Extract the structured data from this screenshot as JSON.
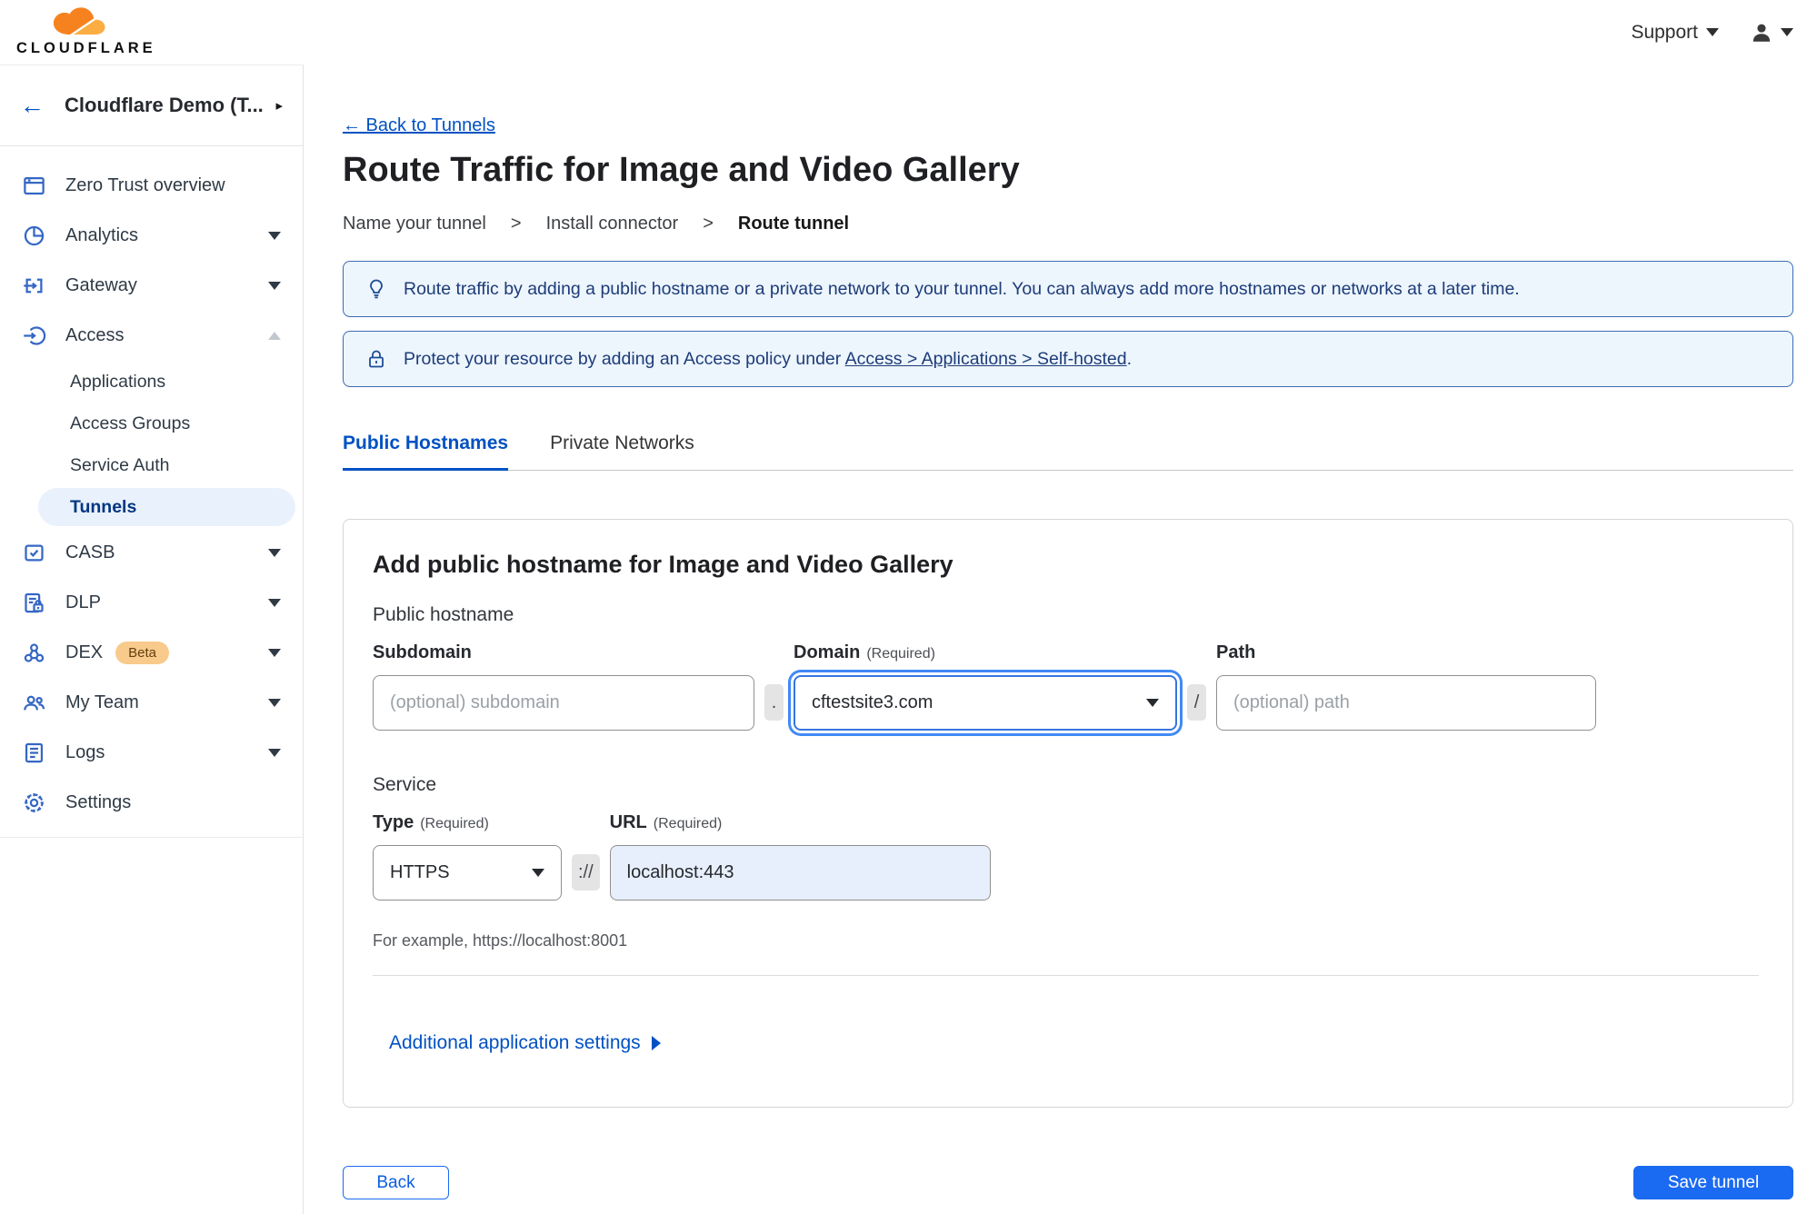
{
  "colors": {
    "accent_blue": "#0051c3",
    "button_blue": "#1a6af2",
    "banner_border": "#3b6cb4",
    "banner_bg": "#edf5fd",
    "active_pill_bg": "#e9f1fc",
    "active_pill_text": "#003681",
    "logo_orange": "#f6821f",
    "logo_orange_light": "#fbad41",
    "beta_badge_bg": "#f8ca8b",
    "url_field_bg": "#e7effc"
  },
  "header": {
    "logo_text": "CLOUDFLARE",
    "support_label": "Support",
    "icons": [
      "support-chevron",
      "user-avatar",
      "user-chevron"
    ]
  },
  "sidebar": {
    "team_name": "Cloudflare Demo (T...",
    "back_arrow": "←",
    "expand_arrow": "▸",
    "items": [
      {
        "label": "Zero Trust overview",
        "icon": "overview-icon",
        "chevron": "none"
      },
      {
        "label": "Analytics",
        "icon": "analytics-icon",
        "chevron": "down"
      },
      {
        "label": "Gateway",
        "icon": "gateway-icon",
        "chevron": "down"
      },
      {
        "label": "Access",
        "icon": "access-icon",
        "chevron": "up"
      },
      {
        "label": "CASB",
        "icon": "casb-icon",
        "chevron": "down"
      },
      {
        "label": "DLP",
        "icon": "dlp-icon",
        "chevron": "down"
      },
      {
        "label": "DEX",
        "icon": "dex-icon",
        "chevron": "down",
        "badge": "Beta"
      },
      {
        "label": "My Team",
        "icon": "team-icon",
        "chevron": "down"
      },
      {
        "label": "Logs",
        "icon": "logs-icon",
        "chevron": "down"
      },
      {
        "label": "Settings",
        "icon": "settings-icon",
        "chevron": "none"
      }
    ],
    "access_subitems": [
      {
        "label": "Applications",
        "active": false
      },
      {
        "label": "Access Groups",
        "active": false
      },
      {
        "label": "Service Auth",
        "active": false
      },
      {
        "label": "Tunnels",
        "active": true
      }
    ]
  },
  "page": {
    "back_link": "← Back to Tunnels",
    "title": "Route Traffic for Image and Video Gallery",
    "steps": [
      "Name your tunnel",
      "Install connector",
      "Route tunnel"
    ],
    "step_separator": ">"
  },
  "banners": [
    {
      "icon": "lightbulb-icon",
      "text": "Route traffic by adding a public hostname or a private network to your tunnel. You can always add more hostnames or networks at a later time."
    },
    {
      "icon": "lock-icon",
      "text_prefix": "Protect your resource by adding an Access policy under ",
      "link_text": "Access > Applications > Self-hosted",
      "text_suffix": "."
    }
  ],
  "tabs": [
    {
      "label": "Public Hostnames",
      "active": true
    },
    {
      "label": "Private Networks",
      "active": false
    }
  ],
  "form": {
    "heading": "Add public hostname for Image and Video Gallery",
    "public_hostname_label": "Public hostname",
    "subdomain": {
      "label": "Subdomain",
      "placeholder": "(optional) subdomain",
      "value": ""
    },
    "domain": {
      "label": "Domain",
      "required": "(Required)",
      "value": "cftestsite3.com"
    },
    "path": {
      "label": "Path",
      "placeholder": "(optional) path",
      "value": ""
    },
    "separators": {
      "dot": ".",
      "slash": "/",
      "scheme": "://"
    },
    "service_label": "Service",
    "type": {
      "label": "Type",
      "required": "(Required)",
      "value": "HTTPS"
    },
    "url": {
      "label": "URL",
      "required": "(Required)",
      "value": "localhost:443"
    },
    "helper": "For example, https://localhost:8001",
    "additional_settings_label": "Additional application settings"
  },
  "footer": {
    "back_label": "Back",
    "save_label": "Save tunnel"
  }
}
